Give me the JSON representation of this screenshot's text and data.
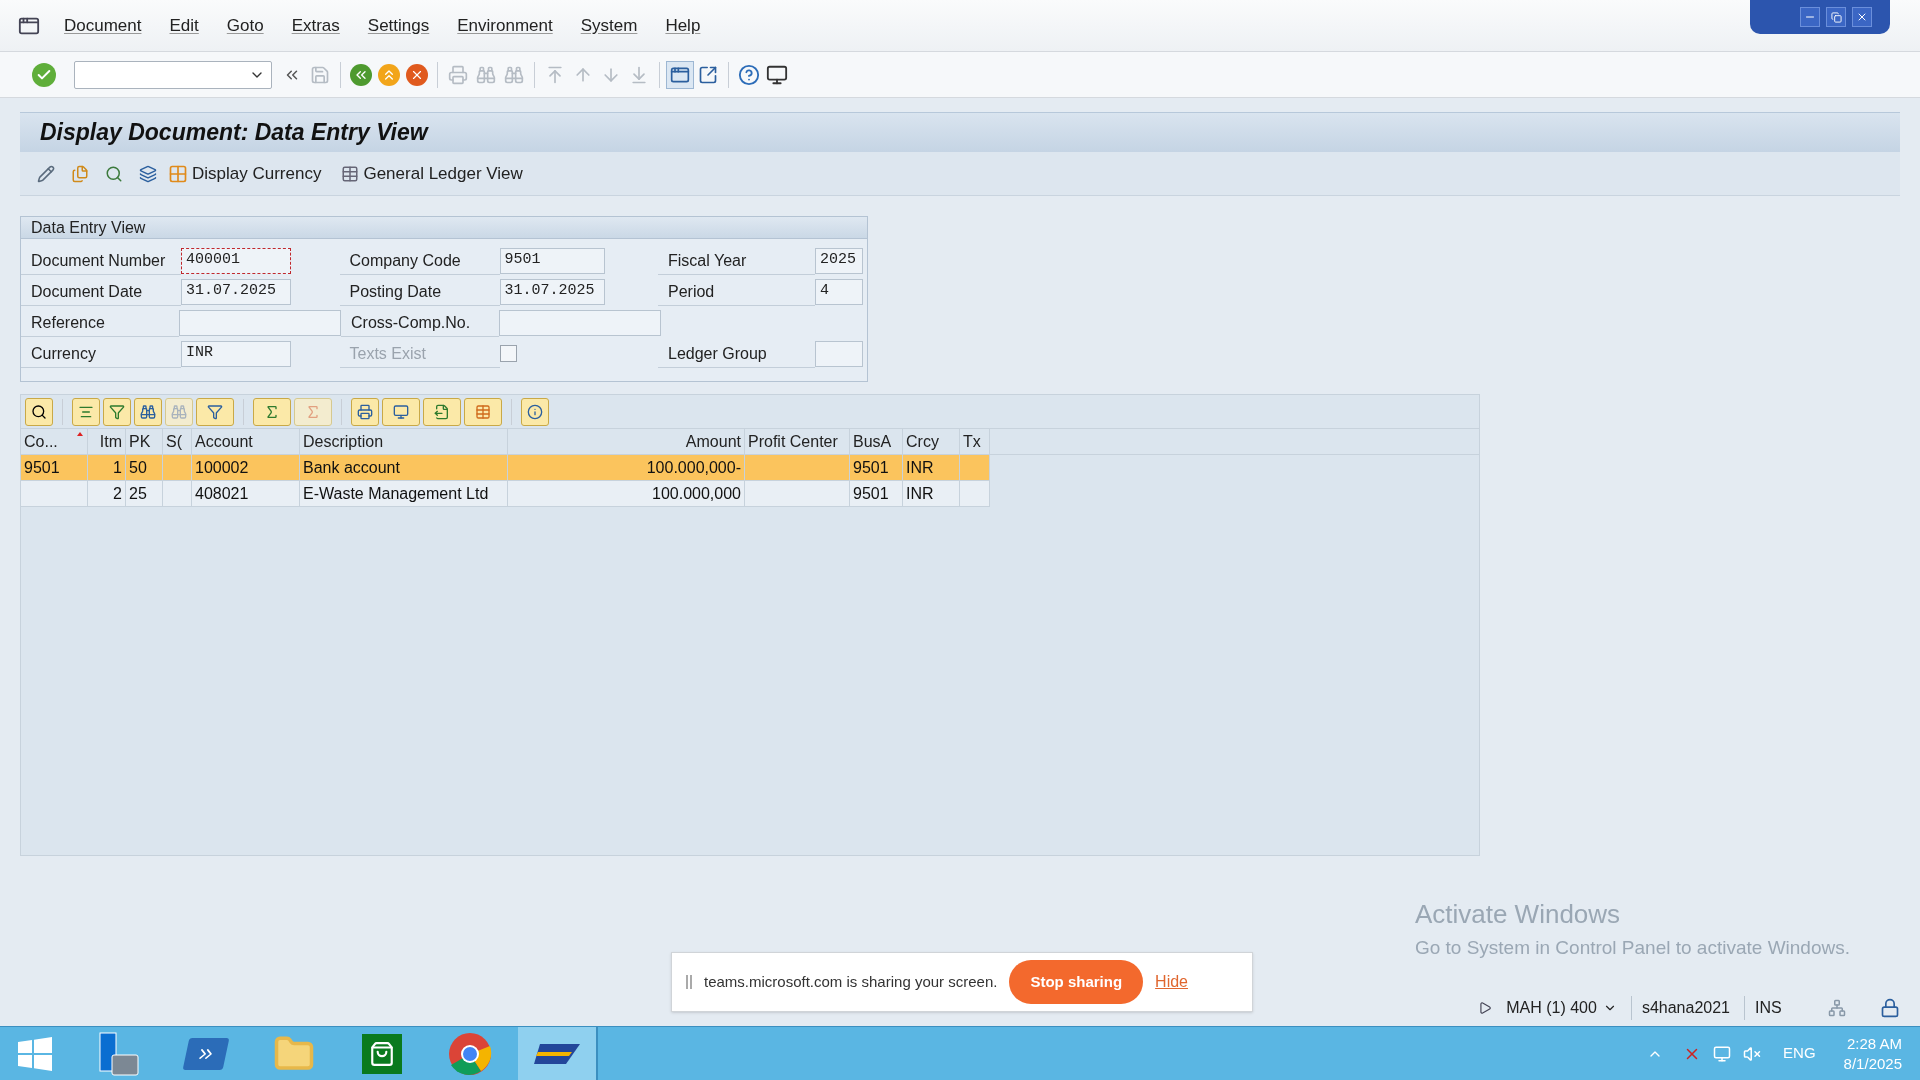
{
  "menu_bar": {
    "items": [
      "Document",
      "Edit",
      "Goto",
      "Extras",
      "Settings",
      "Environment",
      "System",
      "Help"
    ]
  },
  "title": "Display Document: Data Entry View",
  "app_toolbar": {
    "buttons": [
      {
        "label": "Display Currency"
      },
      {
        "label": "General Ledger View"
      }
    ]
  },
  "header_group": {
    "title": "Data Entry View",
    "rows": [
      [
        {
          "kind": "field",
          "label": "Document Number",
          "value": "400001",
          "focused": true
        },
        {
          "kind": "field",
          "label": "Company Code",
          "value": "9501",
          "focused": false
        },
        {
          "kind": "field",
          "label": "Fiscal Year",
          "value": "2025",
          "focused": false
        }
      ],
      [
        {
          "kind": "field",
          "label": "Document Date",
          "value": "31.07.2025",
          "focused": false
        },
        {
          "kind": "field",
          "label": "Posting Date",
          "value": "31.07.2025",
          "focused": false
        },
        {
          "kind": "field",
          "label": "Period",
          "value": "4",
          "focused": false
        }
      ],
      [
        {
          "kind": "field",
          "label": "Reference",
          "focused": false
        },
        {
          "kind": "field",
          "label": "Cross-Comp.No.",
          "focused": false
        }
      ],
      [
        {
          "kind": "field",
          "label": "Currency",
          "value": "INR",
          "focused": false
        },
        {
          "kind": "checkbox",
          "label": "Texts Exist",
          "checked": false,
          "disabled": true
        },
        {
          "kind": "field",
          "label": "Ledger Group",
          "focused": false
        }
      ]
    ]
  },
  "table": {
    "columns": [
      {
        "label": "Co...",
        "sorted": true
      },
      {
        "label": "Itm",
        "sorted": false
      },
      {
        "label": "PK",
        "sorted": false
      },
      {
        "label": "S(",
        "sorted": false
      },
      {
        "label": "Account",
        "sorted": false
      },
      {
        "label": "Description",
        "sorted": false
      },
      {
        "label": "Amount",
        "sorted": false
      },
      {
        "label": "Profit Center",
        "sorted": false
      },
      {
        "label": "BusA",
        "sorted": false
      },
      {
        "label": "Crcy",
        "sorted": false
      },
      {
        "label": "Tx",
        "sorted": false
      }
    ],
    "rows": [
      {
        "selected": true,
        "cells": [
          "9501",
          "1",
          "50",
          "",
          "100002",
          "Bank account",
          "100.000,000-",
          "",
          "9501",
          "INR",
          ""
        ]
      },
      {
        "selected": false,
        "cells": [
          "",
          "2",
          "25",
          "",
          "408021",
          "E-Waste Management Ltd",
          "100.000,000",
          "",
          "9501",
          "INR",
          ""
        ]
      }
    ]
  },
  "activation_notice": {
    "title": "Activate Windows",
    "text": "Go to System in Control Panel to activate Windows."
  },
  "sharing_bar": {
    "message": "teams.microsoft.com is sharing your screen.",
    "stop_button": "Stop sharing",
    "hide_link": "Hide"
  },
  "status_bar": {
    "system": "MAH (1) 400",
    "server": "s4hana2021",
    "mode": "INS"
  },
  "taskbar": {
    "apps": [
      {
        "kind": "server",
        "selected": false
      },
      {
        "kind": "shell",
        "selected": false
      },
      {
        "kind": "folder",
        "selected": false
      },
      {
        "kind": "store",
        "selected": false
      },
      {
        "kind": "browser",
        "selected": false
      },
      {
        "kind": "sap",
        "selected": true
      }
    ],
    "language": "ENG",
    "time": "2:28 AM",
    "date": "8/1/2025"
  }
}
